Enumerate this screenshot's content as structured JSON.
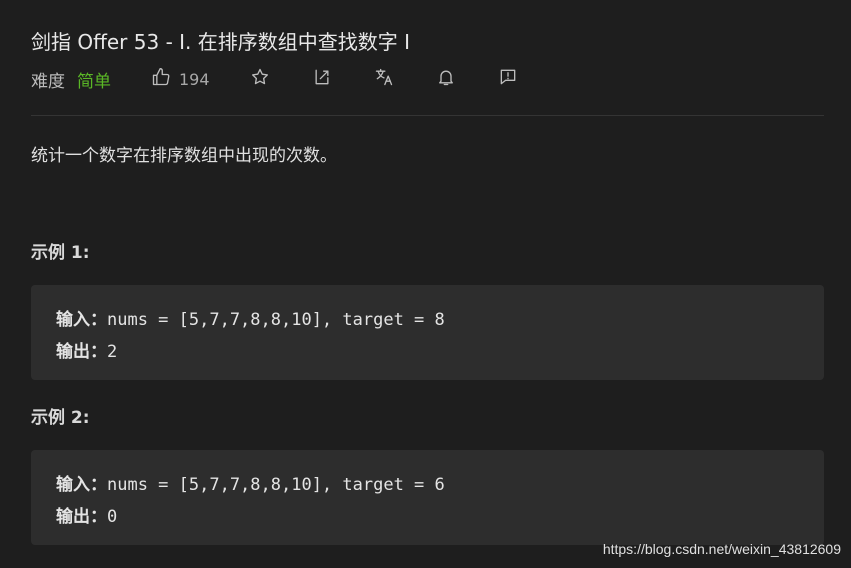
{
  "problem": {
    "title": "剑指 Offer 53 - I. 在排序数组中查找数字 I",
    "difficulty_label": "难度",
    "difficulty_value": "简单",
    "likes": "194",
    "description": "统计一个数字在排序数组中出现的次数。"
  },
  "examples": [
    {
      "title": "示例 1:",
      "input_label": "输入：",
      "input_value": "nums = [5,7,7,8,8,10], target = 8",
      "output_label": "输出：",
      "output_value": "2"
    },
    {
      "title": "示例 2:",
      "input_label": "输入：",
      "input_value": "nums = [5,7,7,8,8,10], target = 6",
      "output_label": "输出：",
      "output_value": "0"
    }
  ],
  "watermark": "https://blog.csdn.net/weixin_43812609",
  "colors": {
    "background": "#1e1e1e",
    "easy": "#5ab726",
    "codebox": "#2d2d2d"
  },
  "icons": [
    "thumbs-up-icon",
    "star-icon",
    "share-icon",
    "translate-icon",
    "bell-icon",
    "feedback-icon"
  ]
}
